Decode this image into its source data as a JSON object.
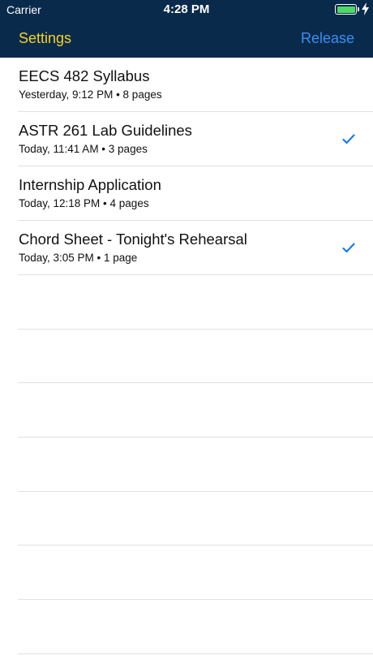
{
  "status_bar": {
    "carrier": "Carrier",
    "time": "4:28 PM",
    "battery_level": 1.0,
    "battery_color": "#4cd964"
  },
  "nav": {
    "left_label": "Settings",
    "right_label": "Release",
    "background": "#0a2a4c",
    "left_color": "#f1d32a",
    "right_color": "#3c8ef0"
  },
  "documents": [
    {
      "title": "EECS 482 Syllabus",
      "subtitle": "Yesterday, 9:12 PM • 8 pages",
      "checked": false
    },
    {
      "title": "ASTR 261 Lab Guidelines",
      "subtitle": "Today, 11:41 AM • 3 pages",
      "checked": true
    },
    {
      "title": "Internship Application",
      "subtitle": "Today, 12:18 PM • 4 pages",
      "checked": false
    },
    {
      "title": "Chord Sheet - Tonight's Rehearsal",
      "subtitle": "Today, 3:05 PM • 1 page",
      "checked": true
    }
  ],
  "icons": {
    "checkmark": "checkmark-icon",
    "charging": "charging-bolt-icon",
    "battery": "battery-icon"
  },
  "accent_check_color": "#1f7ae0"
}
